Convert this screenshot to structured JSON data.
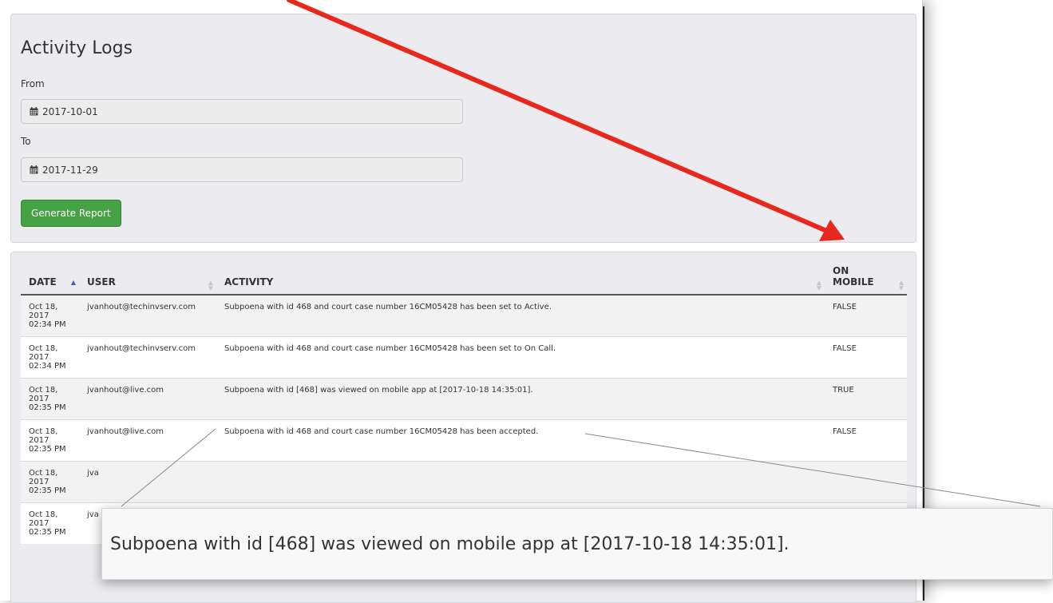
{
  "page": {
    "title": "Activity Logs",
    "from_label": "From",
    "to_label": "To",
    "from_date": "2017-10-01",
    "to_date": "2017-11-29",
    "generate_button": "Generate Report"
  },
  "table": {
    "columns": [
      {
        "label": "DATE",
        "sort": "asc"
      },
      {
        "label": "USER",
        "sort": "none"
      },
      {
        "label": "ACTIVITY",
        "sort": "none"
      },
      {
        "label_line1": "ON",
        "label_line2": "MOBILE",
        "sort": "none"
      }
    ],
    "rows": [
      {
        "date1": "Oct 18,",
        "date2": "2017",
        "date3": "02:34 PM",
        "user": "jvanhout@techinvserv.com",
        "activity": "Subpoena with id 468 and court case number 16CM05428 has been set to Active.",
        "mobile": "FALSE"
      },
      {
        "date1": "Oct 18,",
        "date2": "2017",
        "date3": "02:34 PM",
        "user": "jvanhout@techinvserv.com",
        "activity": "Subpoena with id 468 and court case number 16CM05428 has been set to On Call.",
        "mobile": "FALSE"
      },
      {
        "date1": "Oct 18,",
        "date2": "2017",
        "date3": "02:35 PM",
        "user": "jvanhout@live.com",
        "activity": "Subpoena with id [468] was viewed on mobile app at [2017-10-18 14:35:01].",
        "mobile": "TRUE"
      },
      {
        "date1": "Oct 18,",
        "date2": "2017",
        "date3": "02:35 PM",
        "user": "jvanhout@live.com",
        "activity": "Subpoena with id 468 and court case number 16CM05428 has been accepted.",
        "mobile": "FALSE"
      },
      {
        "date1": "Oct 18,",
        "date2": "2017",
        "date3": "02:35 PM",
        "user": "jva",
        "activity": "",
        "mobile": ""
      },
      {
        "date1": "Oct 18,",
        "date2": "2017",
        "date3": "02:35 PM",
        "user": "jva",
        "activity": "",
        "mobile": ""
      }
    ]
  },
  "callout": {
    "text": "Subpoena with id [468] was viewed on mobile app at [2017-10-18 14:35:01]."
  },
  "colors": {
    "arrow": "#e8281c",
    "button": "#45a245",
    "panel": "#ececf0"
  },
  "icons": {
    "date_field": "calendar-icon",
    "sort": "sort-arrows-icon"
  }
}
